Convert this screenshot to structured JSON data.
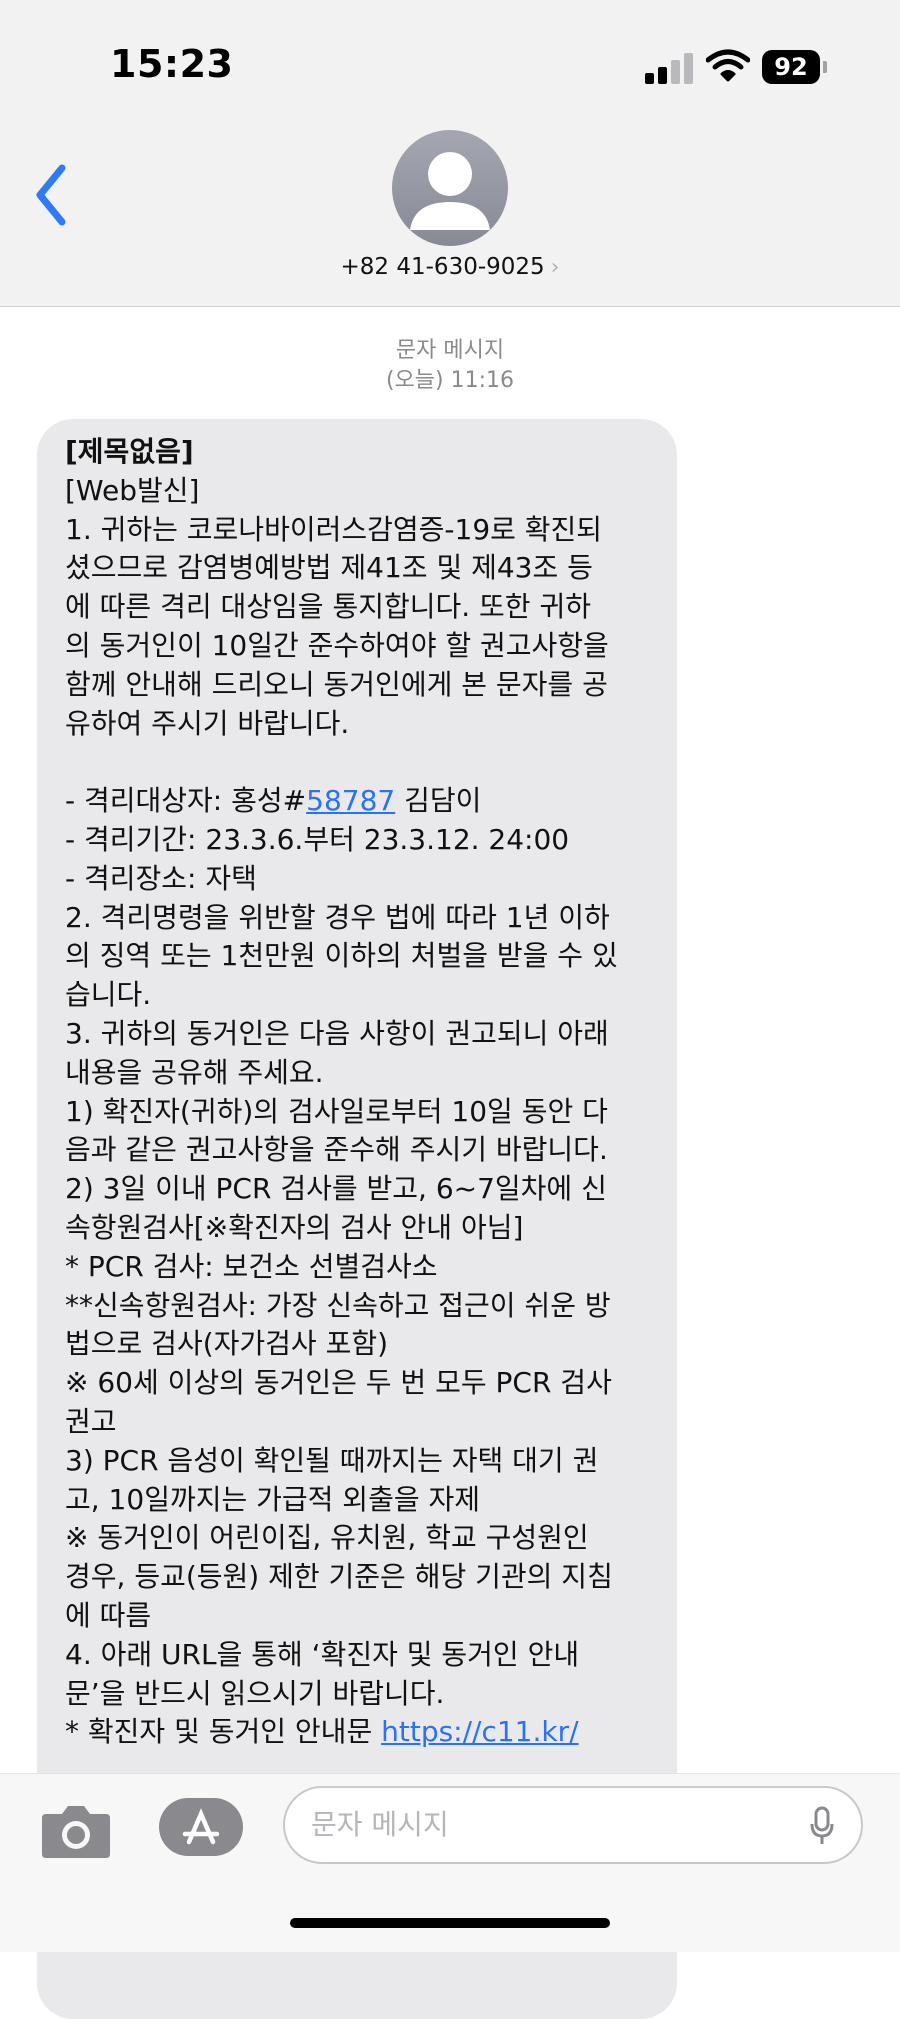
{
  "status": {
    "time": "15:23",
    "battery": "92"
  },
  "header": {
    "contact": "+82 41-630-9025",
    "chevron": "›"
  },
  "thread": {
    "label": "문자 메시지",
    "timestamp": "(오늘) 11:16"
  },
  "message": {
    "lines": [
      "[제목없음]",
      "[Web발신]",
      "1. 귀하는 코로나바이러스감염증-19로 확진되",
      "셨으므로 감염병예방법 제41조 및 제43조 등",
      "에 따른 격리 대상임을 통지합니다. 또한 귀하",
      "의 동거인이 10일간 준수하여야 할 권고사항을",
      "함께 안내해 드리오니 동거인에게 본 문자를 공",
      "유하여 주시기 바랍니다.",
      "",
      "- 격리대상자: 홍성#",
      "- 격리기간: 23.3.6.부터 23.3.12. 24:00",
      "- 격리장소: 자택",
      "2. 격리명령을 위반할 경우 법에 따라 1년 이하",
      "의 징역 또는 1천만원 이하의 처벌을 받을 수 있",
      "습니다.",
      "3. 귀하의 동거인은 다음 사항이 권고되니 아래",
      "내용을 공유해 주세요.",
      "1) 확진자(귀하)의 검사일로부터 10일 동안 다",
      "음과 같은 권고사항을 준수해 주시기 바랍니다.",
      "2) 3일 이내 PCR 검사를 받고, 6~7일차에 신",
      "속항원검사[※확진자의 검사 안내 아님]",
      "* PCR 검사: 보건소 선별검사소",
      "**신속항원검사: 가장 신속하고 접근이 쉬운 방",
      "법으로 검사(자가검사 포함)",
      "※ 60세 이상의 동거인은 두 번 모두 PCR 검사",
      "권고",
      "3) PCR 음성이 확인될 때까지는 자택 대기 권",
      "고, 10일까지는 가급적 외출을 자제",
      "※ 동거인이 어린이집, 유치원, 학교 구성원인",
      "경우, 등교(등원) 제한 기준은 해당 기관의 지침",
      "에 따름",
      "4. 아래 URL을 통해 ‘확진자 및 동거인 안내",
      "문’을 반드시 읽으시기 바랍니다.",
      "* 확진자 및 동거인 안내문 "
    ],
    "case_number": "58787",
    "case_name": " 김담이",
    "url": "https://c11.kr/"
  },
  "composer": {
    "placeholder": "문자 메시지"
  },
  "colors": {
    "link": "#2a72f0",
    "back": "#2f7bf5",
    "bubble": "#e9e9eb"
  }
}
